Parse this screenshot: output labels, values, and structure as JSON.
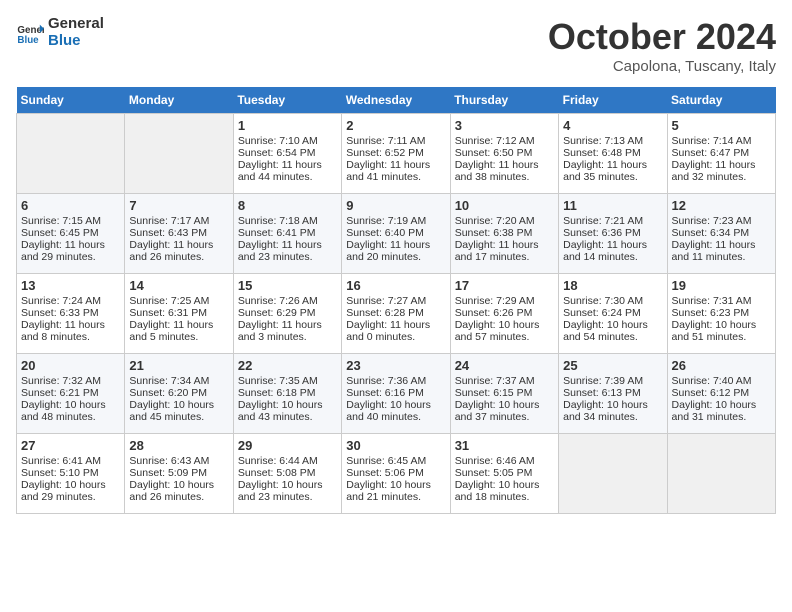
{
  "logo": {
    "line1": "General",
    "line2": "Blue"
  },
  "title": "October 2024",
  "subtitle": "Capolona, Tuscany, Italy",
  "days_of_week": [
    "Sunday",
    "Monday",
    "Tuesday",
    "Wednesday",
    "Thursday",
    "Friday",
    "Saturday"
  ],
  "weeks": [
    [
      {
        "day": "",
        "sunrise": "",
        "sunset": "",
        "daylight": ""
      },
      {
        "day": "",
        "sunrise": "",
        "sunset": "",
        "daylight": ""
      },
      {
        "day": "1",
        "sunrise": "Sunrise: 7:10 AM",
        "sunset": "Sunset: 6:54 PM",
        "daylight": "Daylight: 11 hours and 44 minutes."
      },
      {
        "day": "2",
        "sunrise": "Sunrise: 7:11 AM",
        "sunset": "Sunset: 6:52 PM",
        "daylight": "Daylight: 11 hours and 41 minutes."
      },
      {
        "day": "3",
        "sunrise": "Sunrise: 7:12 AM",
        "sunset": "Sunset: 6:50 PM",
        "daylight": "Daylight: 11 hours and 38 minutes."
      },
      {
        "day": "4",
        "sunrise": "Sunrise: 7:13 AM",
        "sunset": "Sunset: 6:48 PM",
        "daylight": "Daylight: 11 hours and 35 minutes."
      },
      {
        "day": "5",
        "sunrise": "Sunrise: 7:14 AM",
        "sunset": "Sunset: 6:47 PM",
        "daylight": "Daylight: 11 hours and 32 minutes."
      }
    ],
    [
      {
        "day": "6",
        "sunrise": "Sunrise: 7:15 AM",
        "sunset": "Sunset: 6:45 PM",
        "daylight": "Daylight: 11 hours and 29 minutes."
      },
      {
        "day": "7",
        "sunrise": "Sunrise: 7:17 AM",
        "sunset": "Sunset: 6:43 PM",
        "daylight": "Daylight: 11 hours and 26 minutes."
      },
      {
        "day": "8",
        "sunrise": "Sunrise: 7:18 AM",
        "sunset": "Sunset: 6:41 PM",
        "daylight": "Daylight: 11 hours and 23 minutes."
      },
      {
        "day": "9",
        "sunrise": "Sunrise: 7:19 AM",
        "sunset": "Sunset: 6:40 PM",
        "daylight": "Daylight: 11 hours and 20 minutes."
      },
      {
        "day": "10",
        "sunrise": "Sunrise: 7:20 AM",
        "sunset": "Sunset: 6:38 PM",
        "daylight": "Daylight: 11 hours and 17 minutes."
      },
      {
        "day": "11",
        "sunrise": "Sunrise: 7:21 AM",
        "sunset": "Sunset: 6:36 PM",
        "daylight": "Daylight: 11 hours and 14 minutes."
      },
      {
        "day": "12",
        "sunrise": "Sunrise: 7:23 AM",
        "sunset": "Sunset: 6:34 PM",
        "daylight": "Daylight: 11 hours and 11 minutes."
      }
    ],
    [
      {
        "day": "13",
        "sunrise": "Sunrise: 7:24 AM",
        "sunset": "Sunset: 6:33 PM",
        "daylight": "Daylight: 11 hours and 8 minutes."
      },
      {
        "day": "14",
        "sunrise": "Sunrise: 7:25 AM",
        "sunset": "Sunset: 6:31 PM",
        "daylight": "Daylight: 11 hours and 5 minutes."
      },
      {
        "day": "15",
        "sunrise": "Sunrise: 7:26 AM",
        "sunset": "Sunset: 6:29 PM",
        "daylight": "Daylight: 11 hours and 3 minutes."
      },
      {
        "day": "16",
        "sunrise": "Sunrise: 7:27 AM",
        "sunset": "Sunset: 6:28 PM",
        "daylight": "Daylight: 11 hours and 0 minutes."
      },
      {
        "day": "17",
        "sunrise": "Sunrise: 7:29 AM",
        "sunset": "Sunset: 6:26 PM",
        "daylight": "Daylight: 10 hours and 57 minutes."
      },
      {
        "day": "18",
        "sunrise": "Sunrise: 7:30 AM",
        "sunset": "Sunset: 6:24 PM",
        "daylight": "Daylight: 10 hours and 54 minutes."
      },
      {
        "day": "19",
        "sunrise": "Sunrise: 7:31 AM",
        "sunset": "Sunset: 6:23 PM",
        "daylight": "Daylight: 10 hours and 51 minutes."
      }
    ],
    [
      {
        "day": "20",
        "sunrise": "Sunrise: 7:32 AM",
        "sunset": "Sunset: 6:21 PM",
        "daylight": "Daylight: 10 hours and 48 minutes."
      },
      {
        "day": "21",
        "sunrise": "Sunrise: 7:34 AM",
        "sunset": "Sunset: 6:20 PM",
        "daylight": "Daylight: 10 hours and 45 minutes."
      },
      {
        "day": "22",
        "sunrise": "Sunrise: 7:35 AM",
        "sunset": "Sunset: 6:18 PM",
        "daylight": "Daylight: 10 hours and 43 minutes."
      },
      {
        "day": "23",
        "sunrise": "Sunrise: 7:36 AM",
        "sunset": "Sunset: 6:16 PM",
        "daylight": "Daylight: 10 hours and 40 minutes."
      },
      {
        "day": "24",
        "sunrise": "Sunrise: 7:37 AM",
        "sunset": "Sunset: 6:15 PM",
        "daylight": "Daylight: 10 hours and 37 minutes."
      },
      {
        "day": "25",
        "sunrise": "Sunrise: 7:39 AM",
        "sunset": "Sunset: 6:13 PM",
        "daylight": "Daylight: 10 hours and 34 minutes."
      },
      {
        "day": "26",
        "sunrise": "Sunrise: 7:40 AM",
        "sunset": "Sunset: 6:12 PM",
        "daylight": "Daylight: 10 hours and 31 minutes."
      }
    ],
    [
      {
        "day": "27",
        "sunrise": "Sunrise: 6:41 AM",
        "sunset": "Sunset: 5:10 PM",
        "daylight": "Daylight: 10 hours and 29 minutes."
      },
      {
        "day": "28",
        "sunrise": "Sunrise: 6:43 AM",
        "sunset": "Sunset: 5:09 PM",
        "daylight": "Daylight: 10 hours and 26 minutes."
      },
      {
        "day": "29",
        "sunrise": "Sunrise: 6:44 AM",
        "sunset": "Sunset: 5:08 PM",
        "daylight": "Daylight: 10 hours and 23 minutes."
      },
      {
        "day": "30",
        "sunrise": "Sunrise: 6:45 AM",
        "sunset": "Sunset: 5:06 PM",
        "daylight": "Daylight: 10 hours and 21 minutes."
      },
      {
        "day": "31",
        "sunrise": "Sunrise: 6:46 AM",
        "sunset": "Sunset: 5:05 PM",
        "daylight": "Daylight: 10 hours and 18 minutes."
      },
      {
        "day": "",
        "sunrise": "",
        "sunset": "",
        "daylight": ""
      },
      {
        "day": "",
        "sunrise": "",
        "sunset": "",
        "daylight": ""
      }
    ]
  ]
}
